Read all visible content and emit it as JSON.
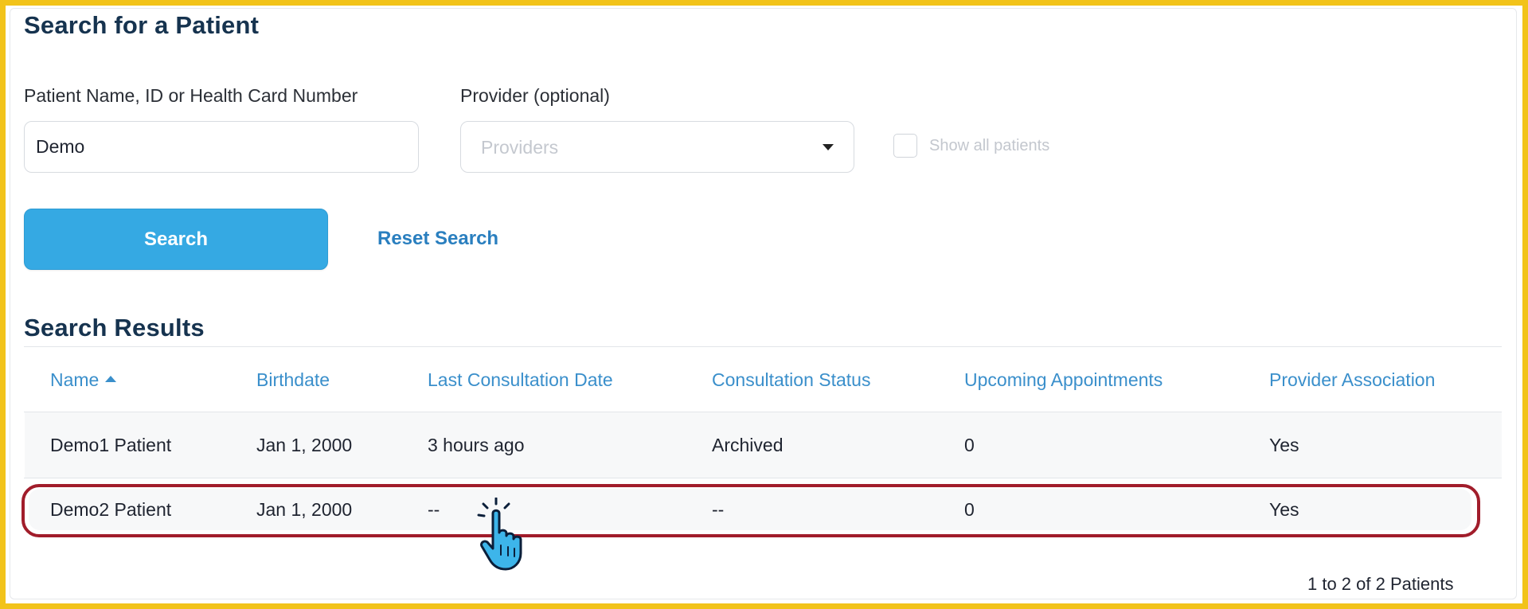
{
  "search_section": {
    "title": "Search for a Patient",
    "patient_field": {
      "label": "Patient Name, ID or Health Card Number",
      "value": "Demo"
    },
    "provider_field": {
      "label": "Provider (optional)",
      "placeholder": "Providers"
    },
    "show_all_checkbox": {
      "label": "Show all patients",
      "checked": false
    },
    "search_button": "Search",
    "reset_link": "Reset Search"
  },
  "results_section": {
    "title": "Search Results",
    "columns": [
      "Name",
      "Birthdate",
      "Last Consultation Date",
      "Consultation Status",
      "Upcoming Appointments",
      "Provider Association"
    ],
    "sort": {
      "column": "Name",
      "direction": "ascending"
    },
    "rows": [
      {
        "name": "Demo1 Patient",
        "birthdate": "Jan 1, 2000",
        "last_consultation": "3 hours ago",
        "status": "Archived",
        "upcoming": "0",
        "association": "Yes"
      },
      {
        "name": "Demo2 Patient",
        "birthdate": "Jan 1, 2000",
        "last_consultation": "--",
        "status": "--",
        "upcoming": "0",
        "association": "Yes"
      }
    ],
    "highlighted_row": 1,
    "pagination": "1 to 2 of 2 Patients"
  },
  "colors": {
    "frame": "#f2c31a",
    "primary": "#35a9e3",
    "heading": "#16334f",
    "link": "#2a7fbf",
    "header_text": "#3a8fcb",
    "highlight": "#a11d2b"
  },
  "icons": {
    "sort": "caret-up-icon",
    "dropdown": "caret-down-icon",
    "cursor": "hand-pointer-icon"
  }
}
